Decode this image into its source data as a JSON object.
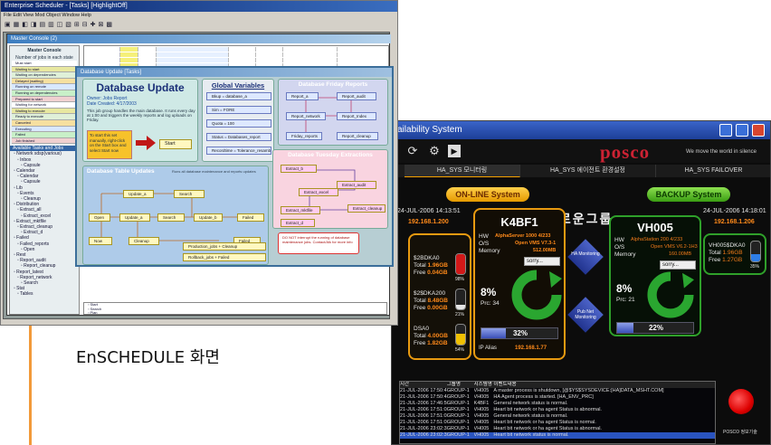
{
  "caption": "EnSCHEDULE 화면",
  "ha_window": {
    "title": "ailability System",
    "brand": "posco",
    "slogan": "We move the world in silence",
    "tabs": [
      {
        "label": "HA_SYS 모니터링",
        "active": true
      },
      {
        "label": "HA_SYS 에이전트 환경설정",
        "active": false
      },
      {
        "label": "HA_SYS FAILOVER",
        "active": false
      }
    ],
    "online_button": "ON-LINE System",
    "backup_button": "BACKUP System",
    "group_name": "새로운그룹",
    "left": {
      "timestamp": "24-JUL-2006 14:13:51",
      "ip": "192.168.1.200",
      "disks": [
        {
          "name": "$2BDKA0",
          "total": "1.96GB",
          "free": "0.04GB",
          "pct": "98%",
          "pct_value": 98,
          "color": "#d21818"
        },
        {
          "name": "$2$DKA200",
          "total": "8.48GB",
          "free": "0.00GB",
          "pct": "21%",
          "pct_value": 21,
          "color": "#e7e7e7"
        },
        {
          "name": "DSA0",
          "total": "4.00GB",
          "free": "1.82GB",
          "pct": "54%",
          "pct_value": 54,
          "color": "#f0c000"
        }
      ]
    },
    "primary_node": {
      "name": "K4BF1",
      "hw_label": "HW",
      "hw": "AlphaServer 1000 4/233",
      "os_label": "O/S",
      "os": "Open VMS V7.3-1",
      "mem_label": "Memory",
      "memory": "512.00MB",
      "select": "sorry...",
      "cpu_pct": "8%",
      "prc": "Prc: 34",
      "load_pct": "32%",
      "load_value": 32,
      "ip_alias_label": "IP Alias",
      "ip_alias": "192.168.1.77"
    },
    "ha_monitoring": "HA Monitoring",
    "pub_net_monitoring": "Pub Net Monitoring",
    "backup_node": {
      "name": "VH005",
      "hw_label": "HW",
      "hw": "AlphaStation 200 4/233",
      "os_label": "O/S",
      "os": "Open VMS V6.2-1H3",
      "mem_label": "Memory",
      "memory": "160.00MB",
      "select": "sorry...",
      "cpu_pct": "8%",
      "prc": "Prc: 21",
      "load_pct": "22%",
      "load_value": 22
    },
    "right": {
      "timestamp": "24-JUL-2006 14:18:01",
      "ip": "192.168.1.206",
      "disk": {
        "name": "VH005$DKA0",
        "total": "1.96GB",
        "free": "1.27GB",
        "pct": "35%",
        "pct_value": 35
      }
    },
    "log": {
      "headers": [
        "시간",
        "그룹명",
        "시스템명",
        "이벤트내용"
      ],
      "rows": [
        [
          "21-JUL-2006 17:50:47",
          "GROUP-1",
          "VH005",
          "A master process is shutdown, [@$YS$SYSDEVICE:[HA]DATA_MSHT.COM]"
        ],
        [
          "21-JUL-2006 17:50:48",
          "GROUP-1",
          "VH005",
          "HA Agent process is started. [HA_ENV_PRC]"
        ],
        [
          "21-JUL-2006 17:46:50",
          "GROUP-1",
          "K4BF1",
          "General network status is normal."
        ],
        [
          "21-JUL-2006 17:51:05",
          "GROUP-1",
          "VH005",
          "Heart bit network or ha agent Status is abnormal."
        ],
        [
          "21-JUL-2006 17:51:05",
          "GROUP-1",
          "VH005",
          "General network status is normal."
        ],
        [
          "21-JUL-2006 17:51:09",
          "GROUP-1",
          "VH005",
          "Heart bit network or ha agent Status is normal."
        ],
        [
          "21-JUL-2006 23:02:32",
          "GROUP-1",
          "VH005",
          "Heart bit network or ha agent Status is abnormal."
        ],
        [
          "21-JUL-2006 23:02:35",
          "GROUP-1",
          "VH005",
          "Heart bit network status is normal."
        ]
      ]
    },
    "footer_brand": "POSCO 정보기술"
  },
  "ens_window": {
    "title": "Enterprise Scheduler - [Tasks] [HighlightOff]",
    "menu": "File Edit View Mod Object Window Help",
    "console_title": "Master Console (2)",
    "left_header": "Master Console",
    "left_sub": "Number of jobs in each state",
    "status_rows": [
      "Must start",
      "Waiting to start",
      "Waiting on dependencies",
      "Delayed (waiting)",
      "Running on remote",
      "Running on dependencies",
      "Prepared to start",
      "Waiting for network",
      "Waiting to execute",
      "Ready to execute",
      "Canceled",
      "Executing",
      "Failed",
      "Job finished"
    ],
    "tree_title": "Available Tasks and Jobs",
    "tree_items": [
      "Network sdsp(various)",
      "Inbox",
      "Capsule",
      "Calendar",
      "Calendar",
      "Capsule",
      "Lib",
      "Events",
      "Cleanup",
      "Distribution",
      "Extract_all",
      "Extract_excel",
      "Extract_mktfile",
      "Extract_cleanup",
      "Extract_d",
      "Failed",
      "Failed_reports",
      "Open",
      "Rest",
      "Report_audit",
      "Report_cleanup",
      "Report_latest",
      "Report_network",
      "Search",
      "Stat",
      "Tables"
    ],
    "doc_title": "Database Update [Tasks]",
    "du_heading": "Database Update",
    "du_owner": "Owner: Jobs Report",
    "du_date": "Date Created: 4/17/2003",
    "du_desc": "This job group handles the main database. It runs every day at 1:00 and triggers the weekly reports and log uploads on Friday.",
    "start_note": "To start this set manually, right-click on the Start box and select Start now",
    "start_label": "Start",
    "gv_heading": "Global Variables",
    "gv_items": [
      "Bkup = database_a",
      "Sim = FORE",
      "Quota = 100",
      "Status = Databases_report",
      "Recordtime = Tolerance_resamble"
    ],
    "fr_heading": "Database Friday Reports",
    "fr_nodes": [
      "Report_a",
      "Report_audit",
      "Report_network",
      "Report_Index",
      "Friday_reports",
      "Report_cleanup"
    ],
    "dtu_heading": "Database Table Updates",
    "dtu_note": "Runs all database maintenance and reports updates",
    "dtu_nodes": [
      "Update_a",
      "Search",
      "Open",
      "Update_a",
      "Search",
      "Update_b",
      "Failed",
      "Now",
      "Cleanup",
      "Failed",
      "Production_jobs + Cleanup",
      "Rollback_jobs + Failed"
    ],
    "te_heading": "Database Tuesday Extractions",
    "te_nodes": [
      "Extract_b",
      "Extract_audit",
      "Extract_excel",
      "Extract_cleanup",
      "Extract_mktfile",
      "Extract_d"
    ],
    "warn_note": "DO NOT interrupt the running of database maintenance jobs. Contact/Alk for more info",
    "bottom_rows": [
      "Start",
      "Search",
      "Plan",
      "Flow",
      "Update_a",
      "Update_b"
    ]
  }
}
